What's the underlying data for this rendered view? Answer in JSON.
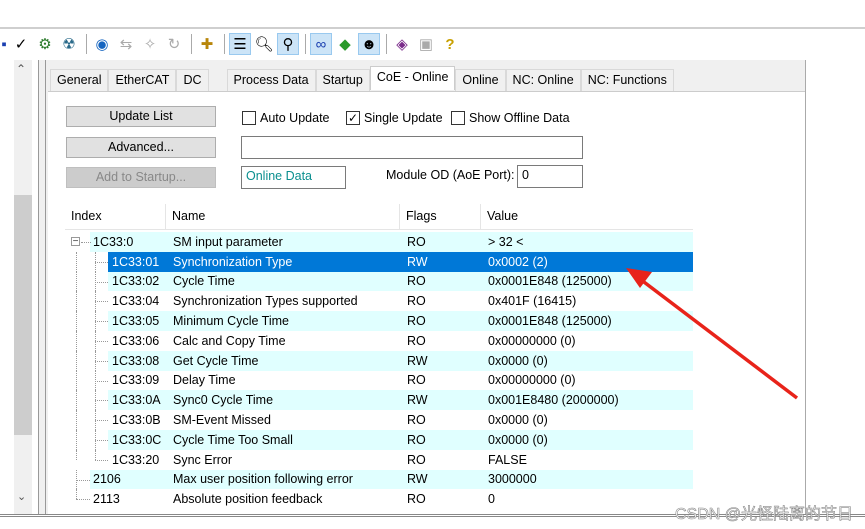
{
  "toolbar": {
    "icons": [
      "checkmark-icon",
      "activate-config-icon",
      "restart-icon",
      "scan-icon",
      "config-mode-icon",
      "wand-icon",
      "reload-icon",
      "add-item-icon",
      "list-icon",
      "search-icon",
      "link-icon",
      "glasses-icon",
      "target-icon",
      "online-icon",
      "book-icon",
      "help-page-icon",
      "help-icon"
    ]
  },
  "tabs": [
    "General",
    "EtherCAT",
    "DC",
    "Process Data",
    "Startup",
    "CoE - Online",
    "Online",
    "NC: Online",
    "NC: Functions"
  ],
  "active_tab": "CoE - Online",
  "buttons": {
    "update_list": "Update List",
    "advanced": "Advanced...",
    "add_to_startup": "Add to Startup..."
  },
  "checkboxes": {
    "auto_update": {
      "label": "Auto Update",
      "checked": false
    },
    "single_update": {
      "label": "Single Update",
      "checked": true
    },
    "show_offline": {
      "label": "Show Offline Data",
      "checked": false
    }
  },
  "fields": {
    "filter": "",
    "online_data": "Online Data",
    "module_od_label": "Module OD (AoE Port):",
    "module_od": "0"
  },
  "table": {
    "columns": [
      "Index",
      "Name",
      "Flags",
      "Value"
    ],
    "rows": [
      {
        "index": "1C33:0",
        "name": "SM input parameter",
        "flags": "RO",
        "value": "> 32 <",
        "level": 0,
        "expander": "minus"
      },
      {
        "index": "1C33:01",
        "name": "Synchronization Type",
        "flags": "RW",
        "value": "0x0002 (2)",
        "level": 1,
        "selected": true
      },
      {
        "index": "1C33:02",
        "name": "Cycle Time",
        "flags": "RO",
        "value": "0x0001E848 (125000)",
        "level": 1
      },
      {
        "index": "1C33:04",
        "name": "Synchronization Types supported",
        "flags": "RO",
        "value": "0x401F (16415)",
        "level": 1
      },
      {
        "index": "1C33:05",
        "name": "Minimum Cycle Time",
        "flags": "RO",
        "value": "0x0001E848 (125000)",
        "level": 1
      },
      {
        "index": "1C33:06",
        "name": "Calc and Copy Time",
        "flags": "RO",
        "value": "0x00000000 (0)",
        "level": 1
      },
      {
        "index": "1C33:08",
        "name": "Get Cycle Time",
        "flags": "RW",
        "value": "0x0000 (0)",
        "level": 1
      },
      {
        "index": "1C33:09",
        "name": "Delay Time",
        "flags": "RO",
        "value": "0x00000000 (0)",
        "level": 1
      },
      {
        "index": "1C33:0A",
        "name": "Sync0 Cycle Time",
        "flags": "RW",
        "value": "0x001E8480 (2000000)",
        "level": 1
      },
      {
        "index": "1C33:0B",
        "name": "SM-Event Missed",
        "flags": "RO",
        "value": "0x0000 (0)",
        "level": 1
      },
      {
        "index": "1C33:0C",
        "name": "Cycle Time Too Small",
        "flags": "RO",
        "value": "0x0000 (0)",
        "level": 1
      },
      {
        "index": "1C33:20",
        "name": "Sync Error",
        "flags": "RO",
        "value": "FALSE",
        "level": 1
      },
      {
        "index": "2106",
        "name": "Max user position following error",
        "flags": "RW",
        "value": "3000000",
        "level": 0
      },
      {
        "index": "2113",
        "name": "Absolute position feedback",
        "flags": "RO",
        "value": "0",
        "level": 0
      }
    ]
  },
  "colors": {
    "selected": "#0078d7",
    "alt_row": "#e0ffff",
    "arrow": "#e8231a",
    "online_data_text": "#0a8f8f"
  },
  "watermark": "CSDN @光怪陆离的节日"
}
